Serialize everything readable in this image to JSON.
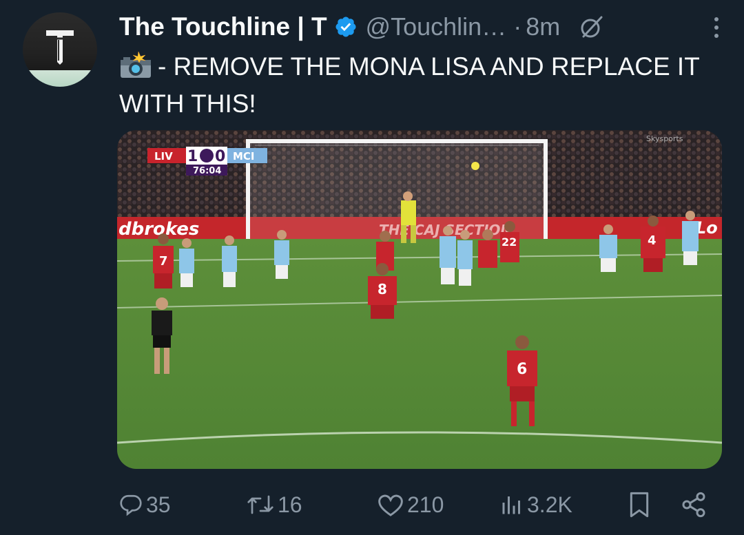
{
  "tweet": {
    "display_name": "The Touchline | T",
    "handle": "@Touchlin…",
    "separator": "·",
    "time": "8m",
    "text": "- REMOVE THE MONA LISA AND REPLACE IT WITH THIS!",
    "icons": {
      "avatar": "touchline-logo",
      "verified": "verified-badge-icon",
      "grok": "grok-icon",
      "more": "more-icon",
      "text_emoji": "camera-flash-emoji"
    },
    "colors": {
      "background": "#15202b",
      "verified": "#1d9bf0",
      "muted": "#8b98a5",
      "text": "#f7f9f9"
    }
  },
  "media": {
    "scorebug": {
      "home": "LIV",
      "score_home": "1",
      "score_away": "0",
      "away": "MCI",
      "clock": "76:04"
    },
    "ad_board": "dbrokes",
    "ad_board_right": "Lo",
    "ad_board_goal": "THE CAJ SECTION",
    "broadcaster": "Skysports",
    "player_numbers": [
      "7",
      "8",
      "6",
      "4",
      "22"
    ]
  },
  "actions": {
    "replies": "35",
    "reposts": "16",
    "likes": "210",
    "views": "3.2K"
  }
}
